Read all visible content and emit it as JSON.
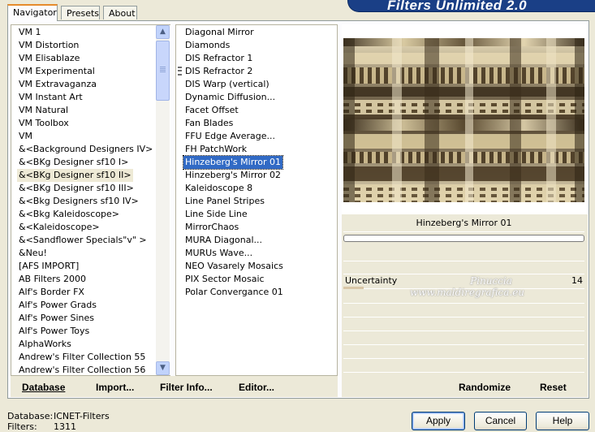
{
  "title": "Filters Unlimited 2.0",
  "tabs": [
    {
      "label": "Navigator"
    },
    {
      "label": "Presets"
    },
    {
      "label": "About"
    }
  ],
  "categories": [
    "VM 1",
    "VM Distortion",
    "VM Elisablaze",
    "VM Experimental",
    "VM Extravaganza",
    "VM Instant Art",
    "VM Natural",
    "VM Toolbox",
    "VM",
    "&<Background Designers IV>",
    "&<BKg Designer sf10 I>",
    "&<BKg Designer sf10 II>",
    "&<BKg Designer sf10 III>",
    "&<Bkg Designers sf10 IV>",
    "&<Bkg Kaleidoscope>",
    "&<Kaleidoscope>",
    "&<Sandflower Specials\"v\" >",
    "&Neu!",
    "[AFS IMPORT]",
    "AB Filters 2000",
    "Alf's Border FX",
    "Alf's Power Grads",
    "Alf's Power Sines",
    "Alf's Power Toys",
    "AlphaWorks",
    "Andrew's Filter Collection 55",
    "Andrew's Filter Collection 56"
  ],
  "filters": [
    "Diagonal Mirror",
    "Diamonds",
    "DIS Refractor 1",
    "DIS Refractor 2",
    "DIS Warp (vertical)",
    "Dynamic Diffusion...",
    "Facet Offset",
    "Fan Blades",
    "FFU Edge Average...",
    "FH PatchWork",
    "Hinzeberg's Mirror 01",
    "Hinzeberg's Mirror 02",
    "Kaleidoscope 8",
    "Line Panel Stripes",
    "Line Side Line",
    "MirrorChaos",
    "MURA Diagonal...",
    "MURUs Wave...",
    "NEO Vasarely Mosaics",
    "PIX Sector Mosaic",
    "Polar Convergance 01"
  ],
  "selected_filter": "Hinzeberg's Mirror 01",
  "preview_label": "Hinzeberg's Mirror 01",
  "parameter": {
    "name": "Uncertainty",
    "value": "14"
  },
  "watermark": {
    "line1": "Pinuccia",
    "line2": "www.maldiregrafica.eu"
  },
  "bottom_left": {
    "database": "Database",
    "import": "Import...",
    "filter_info": "Filter Info...",
    "editor": "Editor..."
  },
  "bottom_right": {
    "randomize": "Randomize",
    "reset": "Reset"
  },
  "status": {
    "database_label": "Database:",
    "database_value": "ICNET-Filters",
    "filters_label": "Filters:",
    "filters_value": "1311"
  },
  "buttons": {
    "apply": "Apply",
    "cancel": "Cancel",
    "help": "Help"
  },
  "colors": {
    "selection": "#316ac5",
    "banner": "#1a3f86",
    "dialog": "#ece9d8"
  }
}
